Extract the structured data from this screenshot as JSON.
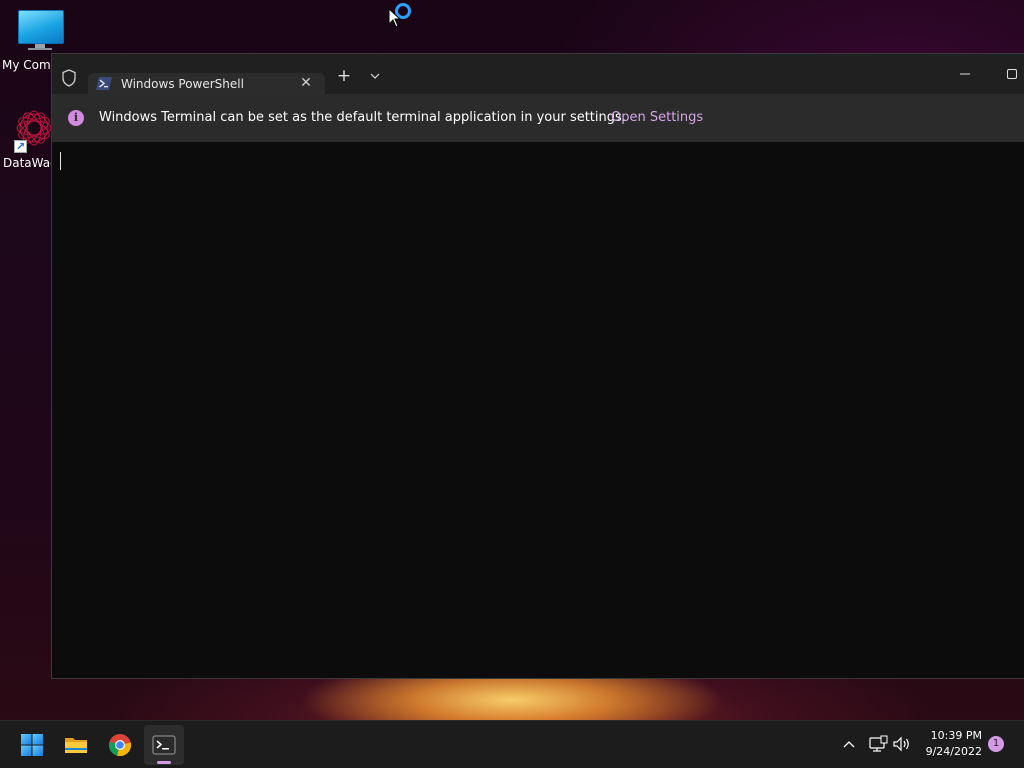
{
  "desktop": {
    "icons": [
      {
        "label": "My Comp",
        "icon": "my-computer-icon"
      },
      {
        "label": "DataWag",
        "icon": "datawag-app-icon"
      }
    ]
  },
  "terminal": {
    "tab": {
      "title": "Windows PowerShell",
      "icon": "powershell-icon",
      "close_glyph": "✕"
    },
    "new_tab_glyph": "+",
    "infobar": {
      "message": "Windows Terminal can be set as the default terminal application in your settings.",
      "link": "Open Settings",
      "icon_glyph": "i",
      "accent": "#d28adf"
    }
  },
  "taskbar": {
    "apps": [
      {
        "name": "start-button",
        "icon": "windows-logo-icon"
      },
      {
        "name": "file-explorer",
        "icon": "folder-icon"
      },
      {
        "name": "chrome",
        "icon": "chrome-icon"
      },
      {
        "name": "terminal",
        "icon": "terminal-icon",
        "active": true
      }
    ],
    "clock": {
      "time": "10:39 PM",
      "date": "9/24/2022"
    },
    "notifications": "1",
    "accent": "#d59ae6"
  }
}
